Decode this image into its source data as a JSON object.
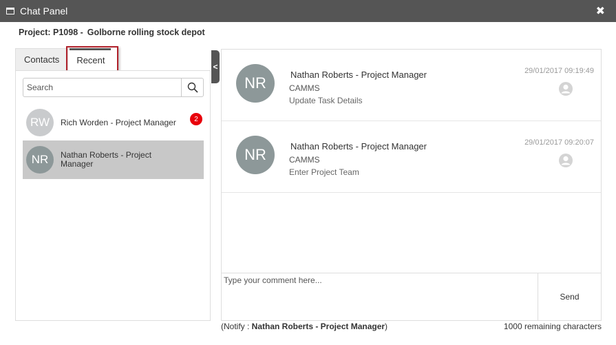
{
  "window": {
    "title": "Chat Panel",
    "close_glyph": "✖"
  },
  "project": {
    "label": "Project: P1098 -",
    "name": "Golborne rolling stock depot"
  },
  "tabs": [
    {
      "label": "Contacts",
      "active": false
    },
    {
      "label": "Recent",
      "active": true
    }
  ],
  "search": {
    "placeholder": "Search"
  },
  "contacts": [
    {
      "initials": "RW",
      "name": "Rich Worden - Project Manager",
      "badge": "2",
      "selected": false
    },
    {
      "initials": "NR",
      "name": "Nathan Roberts - Project Manager",
      "selected": true
    }
  ],
  "collapse_glyph": "<",
  "messages": [
    {
      "initials": "NR",
      "sender": "Nathan Roberts - Project Manager",
      "company": "CAMMS",
      "text": "Update Task Details",
      "time": "29/01/2017 09:19:49"
    },
    {
      "initials": "NR",
      "sender": "Nathan Roberts - Project Manager",
      "company": "CAMMS",
      "text": "Enter Project Team",
      "time": "29/01/2017 09:20:07"
    }
  ],
  "composer": {
    "placeholder": "Type your comment here...",
    "send_label": "Send"
  },
  "footer": {
    "notify_prefix": "(Notify : ",
    "notify_name": "Nathan Roberts - Project Manager",
    "notify_suffix": ")",
    "remaining": "1000 remaining characters"
  },
  "colors": {
    "titlebar": "#555555",
    "badge": "#e8000b",
    "highlight": "#b0202a",
    "avatar": "#8d9899"
  },
  "icons": [
    "window-icon",
    "close-icon",
    "search-icon",
    "user-icon"
  ]
}
